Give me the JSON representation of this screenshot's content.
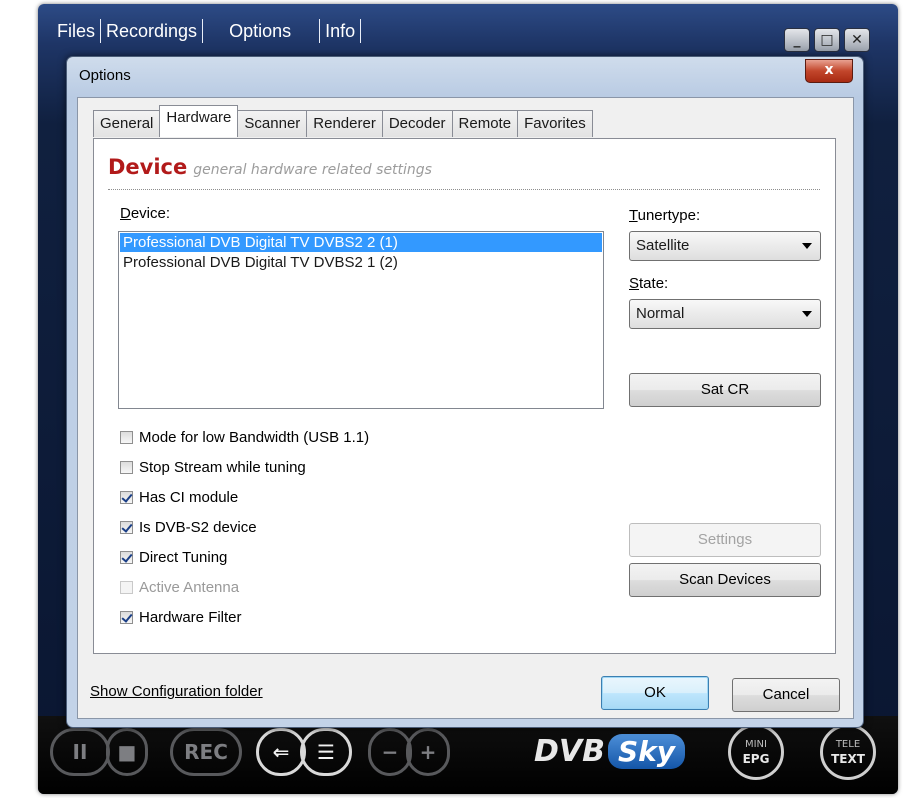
{
  "player": {
    "menu": [
      "Files",
      "Recordings",
      "Options",
      "Info"
    ],
    "window_controls": {
      "minimize": "_",
      "maximize": "□",
      "close": "✕"
    },
    "controls": {
      "pause": "II",
      "stop": "■",
      "rec": "REC",
      "back": "⇐",
      "list": "☰",
      "minus": "−",
      "plus": "+",
      "logo_dvb": "DVB",
      "logo_sky": "Sky",
      "mini_epg_top": "MINI",
      "mini_epg_bottom": "EPG",
      "teletext_top": "TELE",
      "teletext_bottom": "TEXT"
    }
  },
  "dialog": {
    "title": "Options",
    "close": "x",
    "tabs": [
      "General",
      "Hardware",
      "Scanner",
      "Renderer",
      "Decoder",
      "Remote",
      "Favorites"
    ],
    "active_tab": "Hardware",
    "section": {
      "title": "Device",
      "subtitle": "general hardware related settings"
    },
    "device_label_prefix": "",
    "device_label_ul": "D",
    "device_label_rest": "evice:",
    "devices": [
      {
        "name": "Professional DVB Digital TV DVBS2 2 (1)",
        "selected": true
      },
      {
        "name": "Professional DVB Digital TV DVBS2 1 (2)",
        "selected": false
      }
    ],
    "tunertype_label_ul": "T",
    "tunertype_label_rest": "unertype:",
    "tunertype_value": "Satellite",
    "state_label_ul": "S",
    "state_label_rest": "tate:",
    "state_value": "Normal",
    "buttons": {
      "sat_cr": "Sat CR",
      "settings": "Settings",
      "scan_devices": "Scan Devices",
      "ok": "OK",
      "cancel": "Cancel"
    },
    "checkboxes": [
      {
        "label": "Mode for low Bandwidth (USB 1.1)",
        "checked": false,
        "enabled": true
      },
      {
        "label": "Stop Stream while tuning",
        "checked": false,
        "enabled": true
      },
      {
        "label": "Has CI module",
        "checked": true,
        "enabled": true
      },
      {
        "label": "Is DVB-S2 device",
        "checked": true,
        "enabled": true
      },
      {
        "label": "Direct Tuning",
        "checked": true,
        "enabled": true
      },
      {
        "label": "Active Antenna",
        "checked": false,
        "enabled": false
      },
      {
        "label": "Hardware Filter",
        "checked": true,
        "enabled": true
      }
    ],
    "show_config_link": "Show Configuration folder"
  },
  "colors": {
    "section_title": "#b21a1a",
    "selection": "#3399ff",
    "player_bg": "#1e3566"
  }
}
